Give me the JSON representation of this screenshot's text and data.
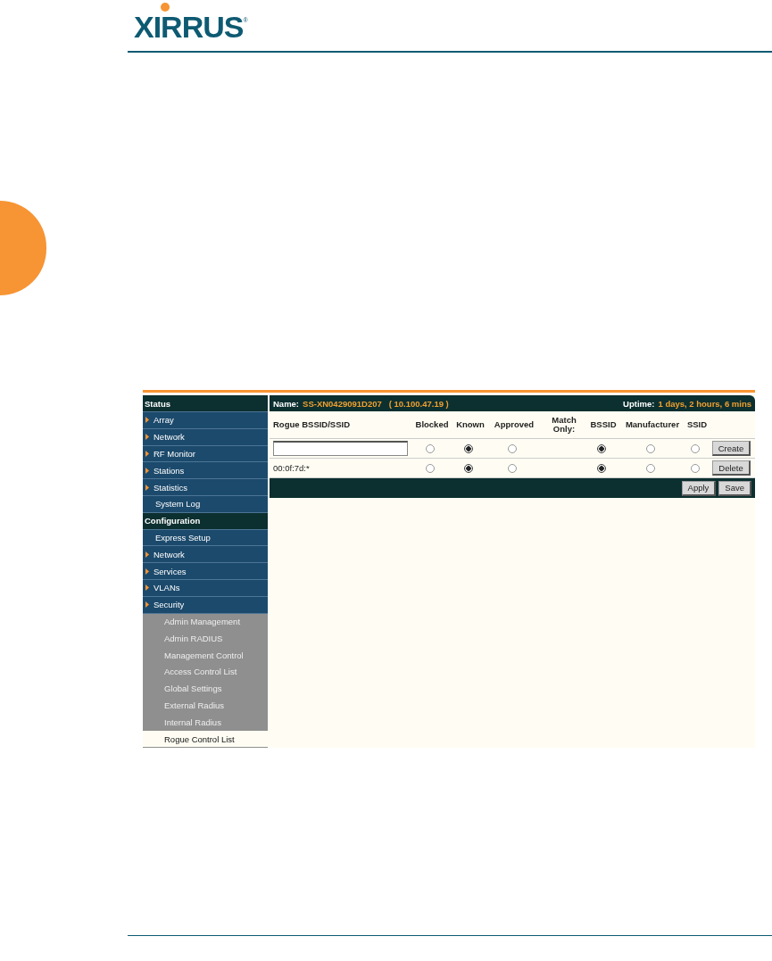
{
  "logo": {
    "name": "XIRRUS",
    "mark": "®"
  },
  "sidebar": [
    {
      "label": "Status",
      "kind": "section",
      "selected": false
    },
    {
      "label": "Array",
      "kind": "group",
      "selected": false
    },
    {
      "label": "Network",
      "kind": "group",
      "selected": false
    },
    {
      "label": "RF Monitor",
      "kind": "group",
      "selected": false
    },
    {
      "label": "Stations",
      "kind": "group",
      "selected": false
    },
    {
      "label": "Statistics",
      "kind": "group",
      "selected": false
    },
    {
      "label": "System Log",
      "kind": "link",
      "selected": false
    },
    {
      "label": "Configuration",
      "kind": "section",
      "selected": false
    },
    {
      "label": "Express Setup",
      "kind": "link",
      "selected": false
    },
    {
      "label": "Network",
      "kind": "group",
      "selected": false
    },
    {
      "label": "Services",
      "kind": "group",
      "selected": false
    },
    {
      "label": "VLANs",
      "kind": "group",
      "selected": false
    },
    {
      "label": "Security",
      "kind": "group",
      "selected": false
    },
    {
      "label": "Admin Management",
      "kind": "sub",
      "selected": false
    },
    {
      "label": "Admin RADIUS",
      "kind": "sub",
      "selected": false
    },
    {
      "label": "Management Control",
      "kind": "sub",
      "selected": false
    },
    {
      "label": "Access Control List",
      "kind": "sub",
      "selected": false
    },
    {
      "label": "Global Settings",
      "kind": "sub",
      "selected": false
    },
    {
      "label": "External Radius",
      "kind": "sub",
      "selected": false
    },
    {
      "label": "Internal Radius",
      "kind": "sub",
      "selected": false
    },
    {
      "label": "Rogue Control List",
      "kind": "sub",
      "selected": true
    }
  ],
  "title_bar": {
    "name_label": "Name:",
    "name": "SS-XN0429091D207   ( 10.100.47.19 )",
    "uptime_label": "Uptime:",
    "uptime": "1 days, 2 hours, 6 mins"
  },
  "columns": [
    "Rogue BSSID/SSID",
    "Blocked",
    "Known",
    "Approved",
    "Match Only:",
    "BSSID",
    "Manufacturer",
    "SSID"
  ],
  "rows": [
    {
      "kind": "input",
      "value": "",
      "status": [
        {
          "selected": false
        },
        {
          "selected": true
        },
        {
          "selected": false
        }
      ],
      "match": [
        {
          "selected": true
        },
        {
          "selected": false
        },
        {
          "selected": false
        }
      ],
      "button": "Create"
    },
    {
      "kind": "text",
      "value": "00:0f:7d:*",
      "status": [
        {
          "selected": false
        },
        {
          "selected": true
        },
        {
          "selected": false
        }
      ],
      "match": [
        {
          "selected": true
        },
        {
          "selected": false
        },
        {
          "selected": false
        }
      ],
      "button": "Delete"
    }
  ],
  "actions": [
    "Apply",
    "Save"
  ]
}
